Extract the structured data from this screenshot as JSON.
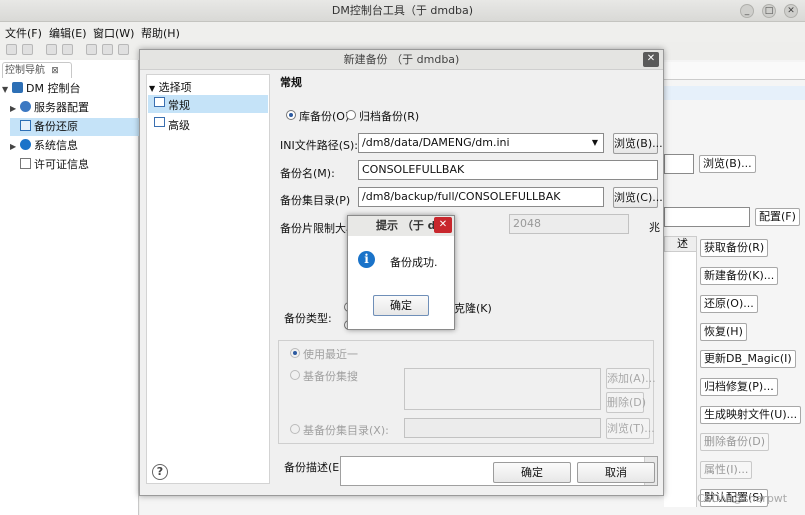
{
  "window": {
    "title": "DM控制台工具（于 dmdba)",
    "controls": [
      "_",
      "□",
      "✕"
    ]
  },
  "menu": [
    "文件(F)",
    "编辑(E)",
    "窗口(W)",
    "帮助(H)"
  ],
  "navigator": {
    "tab_label": "控制导航",
    "tab_close": "⊠",
    "items": [
      {
        "label": "DM 控制台",
        "expand": "▼"
      },
      {
        "label": "服务器配置",
        "expand": "▶"
      },
      {
        "label": "备份还原",
        "expand": ""
      },
      {
        "label": "系统信息",
        "expand": "▶"
      },
      {
        "label": "许可证信息",
        "expand": ""
      }
    ]
  },
  "right_panel": {
    "browse_label": "浏览(B)...",
    "config_label": "配置(F)",
    "column_fragment": "述",
    "actions": [
      {
        "label": "获取备份(R)",
        "enabled": true
      },
      {
        "label": "新建备份(K)...",
        "enabled": true
      },
      {
        "label": "还原(O)...",
        "enabled": true
      },
      {
        "label": "恢复(H)",
        "enabled": true
      },
      {
        "label": "更新DB_Magic(I)",
        "enabled": true
      },
      {
        "label": "归档修复(P)...",
        "enabled": true
      },
      {
        "label": "生成映射文件(U)...",
        "enabled": true
      },
      {
        "label": "删除备份(D)",
        "enabled": false
      },
      {
        "label": "属性(I)...",
        "enabled": false
      },
      {
        "label": "默认配置(S)",
        "enabled": true
      }
    ],
    "watermark": "CSDN @sharpwt"
  },
  "dialog": {
    "title": "新建备份 （于 dmdba)",
    "close": "✕",
    "tree_header": "选择项",
    "tree_items": [
      "常规",
      "高级"
    ],
    "section_title": "常规",
    "backup_modes": [
      "库备份(O)",
      "归档备份(R)"
    ],
    "ini_label": "INI文件路径(S):",
    "ini_value": "/dm8/data/DAMENG/dm.ini",
    "ini_browse": "浏览(B)...",
    "name_label": "备份名(M):",
    "name_value": "CONSOLEFULLBAK",
    "dir_label": "备份集目录(P)",
    "dir_value": "/dm8/backup/full/CONSOLEFULLBAK",
    "dir_browse": "浏览(C)...",
    "size_label": "备份片限制大小",
    "size_value": "2048",
    "size_unit": "兆",
    "type_label": "备份类型:",
    "type_option_clone": "克隆(K)",
    "use_latest": "使用最近一",
    "base_set": "基备份集搜",
    "add": "添加(A)...",
    "remove": "删除(D)",
    "base_dir": "基备份集目录(X):",
    "base_browse": "浏览(T)...",
    "desc_label": "备份描述(E):",
    "help": "?",
    "ok": "确定",
    "cancel": "取消"
  },
  "prompt": {
    "title": "提示 （于 dm",
    "close": "✕",
    "message": "备份成功.",
    "ok": "确定"
  }
}
